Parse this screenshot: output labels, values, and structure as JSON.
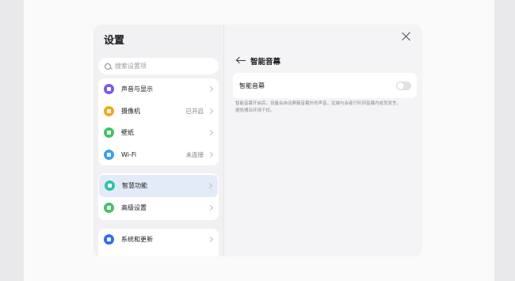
{
  "left_pane": {
    "title": "设置",
    "search_placeholder": "搜索设置项",
    "group1": [
      {
        "label": "声音与显示",
        "value": "",
        "icon": "speaker-icon",
        "color": "#7a5af0"
      },
      {
        "label": "摄像机",
        "value": "已开启",
        "icon": "camera-icon",
        "color": "#f5a623"
      },
      {
        "label": "壁纸",
        "value": "",
        "icon": "wallpaper-icon",
        "color": "#3cc46a"
      },
      {
        "label": "Wi-Fi",
        "value": "未连接",
        "icon": "wifi-icon",
        "color": "#3aa0f0"
      }
    ],
    "group2": [
      {
        "label": "智慧功能",
        "value": "",
        "icon": "smart-features-icon",
        "color": "#31c2a8"
      },
      {
        "label": "高级设置",
        "value": "",
        "icon": "advanced-settings-icon",
        "color": "#44c26a"
      }
    ],
    "group3": [
      {
        "label": "系统和更新",
        "value": "",
        "icon": "system-update-icon",
        "color": "#2f6df0"
      }
    ]
  },
  "right_pane": {
    "title": "智能音幕",
    "setting_label": "智能音幕",
    "toggle_on": false,
    "description": "智能音幕开启后，设备会自动屏蔽音幕外的声音，远端与会者只听到音幕内成员发言，避免嘈杂环境干扰。"
  }
}
